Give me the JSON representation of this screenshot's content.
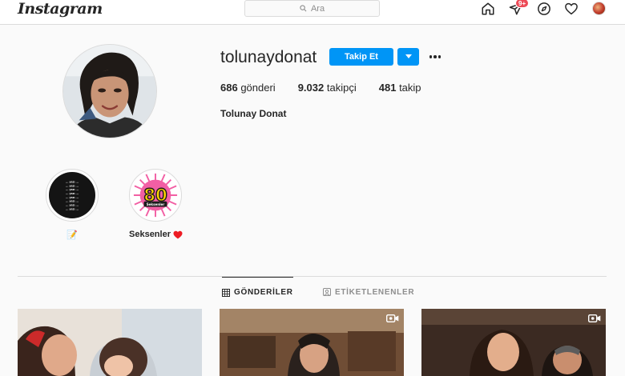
{
  "nav": {
    "logo": "Instagram",
    "search_placeholder": "Ara",
    "notification_badge": "9+",
    "icons": [
      "home-icon",
      "direct-icon",
      "explore-icon",
      "activity-heart-icon",
      "profile-avatar"
    ]
  },
  "profile": {
    "username": "tolunaydonat",
    "follow_label": "Takip Et",
    "full_name": "Tolunay Donat",
    "stats": {
      "posts_count": "686",
      "posts_label": "gönderi",
      "followers_count": "9.032",
      "followers_label": "takipçi",
      "following_count": "481",
      "following_label": "takip"
    }
  },
  "highlights": [
    {
      "label": "📝",
      "cover_text": "... yazı ..."
    },
    {
      "label": "Seksenler",
      "cover_logo": "80",
      "cover_caption": "Seksenler"
    }
  ],
  "tabs": [
    {
      "label": "GÖNDERİLER",
      "active": true
    },
    {
      "label": "ETİKETLENENLER",
      "active": false
    }
  ],
  "posts": [
    {
      "type": "photo"
    },
    {
      "type": "video"
    },
    {
      "type": "video"
    }
  ],
  "colors": {
    "accent": "#0095f6",
    "badge": "#ed4956",
    "heart": "#ed1c24",
    "border": "#dbdbdb",
    "muted": "#8e8e8e"
  }
}
